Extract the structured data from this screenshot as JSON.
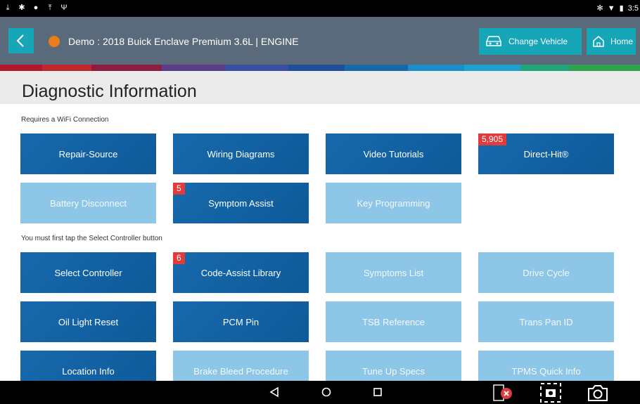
{
  "status_bar": {
    "time": "3:5"
  },
  "app_bar": {
    "vehicle_title": "Demo : 2018 Buick Enclave Premium 3.6L | ENGINE",
    "change_vehicle_label": "Change Vehicle",
    "home_label": "Home"
  },
  "page": {
    "title": "Diagnostic Information"
  },
  "sections": {
    "wifi_label": "Requires a WiFi Connection",
    "controller_label": "You must first tap the Select Controller button"
  },
  "tiles": {
    "repair_source": "Repair-Source",
    "wiring_diagrams": "Wiring Diagrams",
    "video_tutorials": "Video Tutorials",
    "direct_hit": "Direct-Hit®",
    "direct_hit_badge": "5,905",
    "battery_disconnect": "Battery Disconnect",
    "symptom_assist": "Symptom Assist",
    "symptom_assist_badge": "5",
    "key_programming": "Key Programming",
    "select_controller": "Select Controller",
    "code_assist_library": "Code-Assist Library",
    "code_assist_badge": "6",
    "symptoms_list": "Symptoms List",
    "drive_cycle": "Drive Cycle",
    "oil_light_reset": "Oil Light Reset",
    "pcm_pin": "PCM Pin",
    "tsb_reference": "TSB Reference",
    "trans_pan_id": "Trans Pan ID",
    "location_info": "Location Info",
    "brake_bleed_procedure": "Brake Bleed Procedure",
    "tune_up_specs": "Tune Up Specs",
    "tpms_quick_info": "TPMS Quick Info"
  },
  "colors": {
    "app_bar": "#5b6a7a",
    "accent_teal": "#17a5b8",
    "tile_dark": "#1769ac",
    "tile_light": "#8ec6e8",
    "badge_red": "#e03c3c"
  }
}
